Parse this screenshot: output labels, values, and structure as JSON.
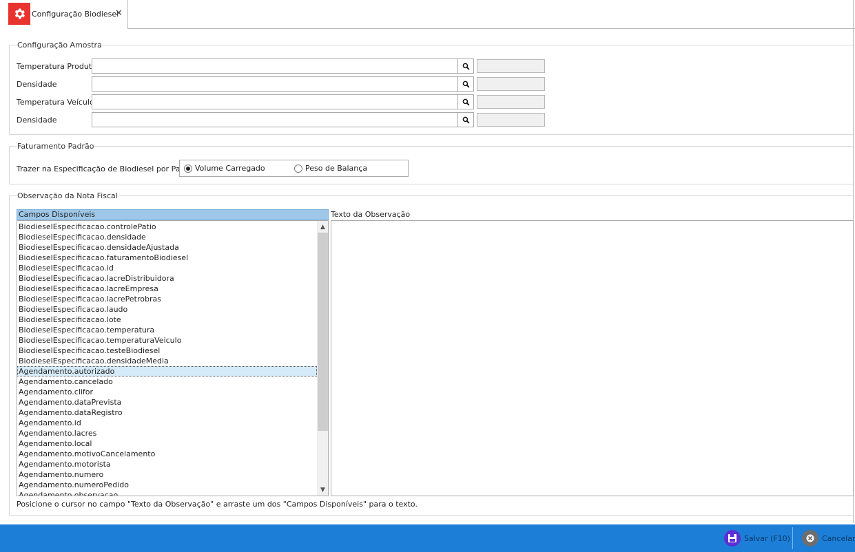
{
  "window": {
    "tab_title": "Configuração Biodiesel",
    "close_glyph": "✕"
  },
  "amostra": {
    "group_title": "Configuração Amostra",
    "rows": [
      {
        "label": "Temperatura Produto",
        "value": "",
        "description": ""
      },
      {
        "label": "Densidade",
        "value": "",
        "description": ""
      },
      {
        "label": "Temperatura Veículo",
        "value": "",
        "description": ""
      },
      {
        "label": "Densidade",
        "value": "",
        "description": ""
      }
    ]
  },
  "faturamento": {
    "group_title": "Faturamento Padrão",
    "label": "Trazer na Especificação de Biodiesel por Padrão",
    "options": [
      {
        "label": "Volume Carregado",
        "selected": true
      },
      {
        "label": "Peso de Balança",
        "selected": false
      }
    ]
  },
  "observacao": {
    "group_title": "Observação da Nota Fiscal",
    "fields_header": "Campos Disponíveis",
    "text_label": "Texto da Observação",
    "text_value": "",
    "selected_index": 14,
    "fields": [
      "BiodieselEspecificacao.controlePatio",
      "BiodieselEspecificacao.densidade",
      "BiodieselEspecificacao.densidadeAjustada",
      "BiodieselEspecificacao.faturamentoBiodiesel",
      "BiodieselEspecificacao.id",
      "BiodieselEspecificacao.lacreDistribuidora",
      "BiodieselEspecificacao.lacreEmpresa",
      "BiodieselEspecificacao.lacrePetrobras",
      "BiodieselEspecificacao.laudo",
      "BiodieselEspecificacao.lote",
      "BiodieselEspecificacao.temperatura",
      "BiodieselEspecificacao.temperaturaVeiculo",
      "BiodieselEspecificacao.testeBiodiesel",
      "BiodieselEspecificacao.densidadeMedia",
      "Agendamento.autorizado",
      "Agendamento.cancelado",
      "Agendamento.clifor",
      "Agendamento.dataPrevista",
      "Agendamento.dataRegistro",
      "Agendamento.id",
      "Agendamento.lacres",
      "Agendamento.local",
      "Agendamento.motivoCancelamento",
      "Agendamento.motorista",
      "Agendamento.numero",
      "Agendamento.numeroPedido",
      "Agendamento.observacao"
    ],
    "hint": "Posicione o cursor no campo \"Texto da Observação\" e arraste um dos \"Campos Disponíveis\" para o texto."
  },
  "footer": {
    "save_label": "Salvar (F10)",
    "cancel_label": "Cancelar",
    "save_icon": "floppy-disk-icon",
    "cancel_icon": "close-circle-icon",
    "save_icon_color": "#5b2fd6",
    "cancel_icon_color": "#6e6e6e",
    "bar_color": "#1c7ed6"
  },
  "icons": {
    "tab": "gear-icon",
    "lookup": "search-icon"
  }
}
